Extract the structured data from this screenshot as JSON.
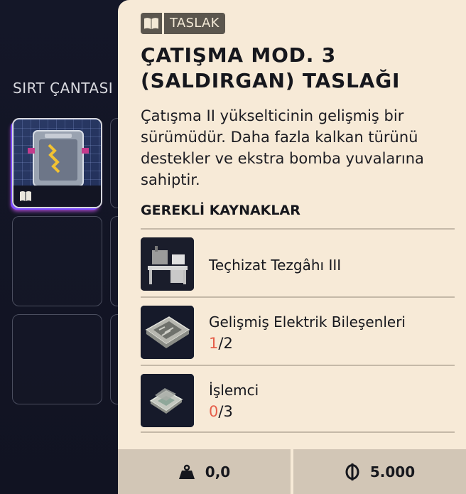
{
  "backpack": {
    "title": "SIRT ÇANTASI"
  },
  "card": {
    "badge_label": "TASLAK",
    "title": "ÇATIŞMA MOD. 3 (SALDIRGAN) TASLAĞI",
    "description": "Çatışma II yükselticinin gelişmiş bir sürümüdür. Daha fazla kalkan türünü destekler ve ekstra bomba yuvalarına sahiptir.",
    "requirements_title": "GEREKLİ KAYNAKLAR",
    "requirements": [
      {
        "name": "Teçhizat Tezgâhı III",
        "icon": "workbench-icon"
      },
      {
        "name": "Gelişmiş Elektrik Bileşenleri",
        "have": "1",
        "sep": "/",
        "need": "2",
        "icon": "circuit-board-icon"
      },
      {
        "name": "İşlemci",
        "have": "0",
        "sep": "/",
        "need": "3",
        "icon": "processor-icon"
      }
    ],
    "footer": {
      "weight": "0,0",
      "price": "5.000"
    }
  },
  "colors": {
    "card_bg": "#f7ead7",
    "missing_count": "#e55e4a",
    "footer_bg": "#d2c6b6",
    "badge_bg": "#5b564e"
  }
}
